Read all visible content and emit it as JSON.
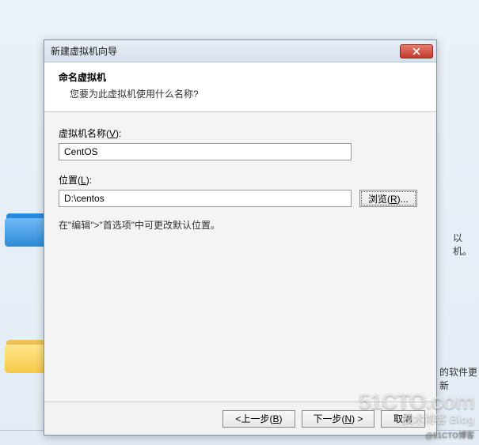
{
  "dialog": {
    "title": "新建虚拟机向导",
    "header_title": "命名虚拟机",
    "header_sub": "您要为此虚拟机使用什么名称?",
    "name_label_pre": "虚拟机名称(",
    "name_label_key": "V",
    "name_label_post": "):",
    "name_value": "CentOS",
    "location_label_pre": "位置(",
    "location_label_key": "L",
    "location_label_post": "):",
    "location_value": "D:\\centos",
    "browse_pre": "浏览(",
    "browse_key": "R",
    "browse_post": ")...",
    "hint": "在\"编辑\">\"首选项\"中可更改默认位置。",
    "back_pre": "<上一步(",
    "back_key": "B",
    "back_post": ")",
    "next_pre": "下一步(",
    "next_key": "N",
    "next_post": ") >",
    "cancel": "取消"
  },
  "desktop": {
    "text1": "以机。",
    "text2": "的软件更新"
  },
  "watermark": {
    "line1": "51CTO.com",
    "line2": "技术博客  Blog",
    "line3": "@51CTO博客"
  }
}
